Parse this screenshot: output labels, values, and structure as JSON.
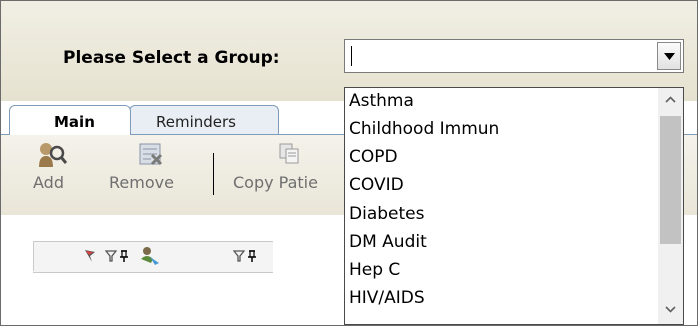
{
  "group_selector": {
    "label": "Please Select a Group:",
    "value": ""
  },
  "tabs": [
    {
      "label": "Main",
      "selected": true
    },
    {
      "label": "Reminders",
      "selected": false
    }
  ],
  "toolbar": {
    "add_label": "Add",
    "remove_label": "Remove",
    "copy_label": "Copy Patie"
  },
  "grid_header_icons": [
    "flag-filter-icon",
    "funnel-filter-icon",
    "pin-icon",
    "person-filter-icon",
    "funnel-filter-icon",
    "pin-icon"
  ],
  "group_options": [
    "Asthma",
    "Childhood Immun",
    "COPD",
    "COVID",
    "Diabetes",
    "DM Audit",
    "Hep C",
    "HIV/AIDS"
  ],
  "colors": {
    "header_bg": "#e6e2d0",
    "tab_border": "#7f9db9",
    "scroll_thumb": "#c2c2c2"
  }
}
